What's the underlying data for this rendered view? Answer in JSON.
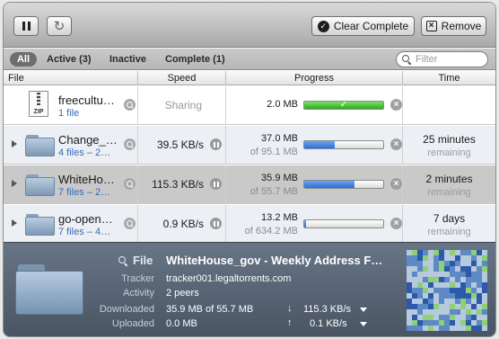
{
  "toolbar": {
    "pause_icon": "pause-icon",
    "reload_icon": "reload-icon",
    "clear_label": "Clear Complete",
    "remove_label": "Remove"
  },
  "filters": {
    "all": "All",
    "active": "Active (3)",
    "inactive": "Inactive",
    "complete": "Complete (1)",
    "search_placeholder": "Filter"
  },
  "columns": {
    "file": "File",
    "speed": "Speed",
    "progress": "Progress",
    "time": "Time"
  },
  "rows": [
    {
      "name": "freecultu…",
      "sub": "1 file",
      "type": "zip",
      "zip_label": "ZIP",
      "speed": "Sharing",
      "progress_main": "2.0 MB",
      "progress_sub": "",
      "progress_fraction": 1.0,
      "status_glyph": "✓",
      "time_main": "",
      "time_sub": ""
    },
    {
      "name": "Change_…",
      "sub": "4 files – 2…",
      "type": "folder",
      "speed": "39.5 KB/s",
      "progress_main": "37.0 MB",
      "progress_sub": "of 95.1 MB",
      "progress_fraction": 0.39,
      "time_main": "25 minutes",
      "time_sub": "remaining"
    },
    {
      "name": "WhiteHo…",
      "sub": "7 files – 2…",
      "type": "folder",
      "speed": "115.3 KB/s",
      "progress_main": "35.9 MB",
      "progress_sub": "of 55.7 MB",
      "progress_fraction": 0.64,
      "time_main": "2 minutes",
      "time_sub": "remaining"
    },
    {
      "name": "go-open…",
      "sub": "7 files – 4…",
      "type": "folder",
      "speed": "0.9 KB/s",
      "progress_main": "13.2 MB",
      "progress_sub": "of 634.2 MB",
      "progress_fraction": 0.02,
      "time_main": "7 days",
      "time_sub": "remaining"
    }
  ],
  "info": {
    "file_label": "File",
    "title": "WhiteHouse_gov - Weekly Address F…",
    "tracker_label": "Tracker",
    "tracker": "tracker001.legaltorrents.com",
    "activity_label": "Activity",
    "activity": "2 peers",
    "downloaded_label": "Downloaded",
    "downloaded": "35.9 MB of 55.7 MB",
    "down_arrow": "↓",
    "down_speed": "115.3 KB/s",
    "uploaded_label": "Uploaded",
    "uploaded": "0.0 MB",
    "up_arrow": "↑",
    "up_speed": "0.1 KB/s"
  },
  "colors": {
    "progress_blue": "#2a6fd8",
    "progress_green": "#2fa822",
    "link_blue": "#3b69b4",
    "panel": "#5a6676",
    "pieces_dark": "#2c5aa8",
    "pieces_mid": "#5d89c4",
    "pieces_light": "#b6c9de",
    "pieces_green": "#8fcf7a"
  }
}
